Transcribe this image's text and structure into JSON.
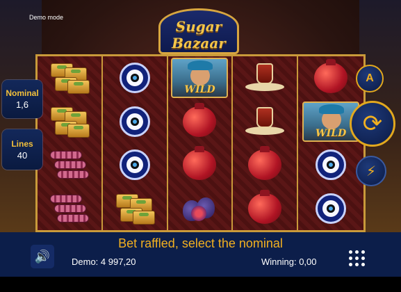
{
  "header": {
    "mode_label": "Demo mode",
    "logo_line1": "Sugar",
    "logo_line2": "Bazaar"
  },
  "reels": [
    [
      "baklava",
      "baklava",
      "turkish-delight-rolls",
      "turkish-delight-rolls"
    ],
    [
      "evil-eye",
      "evil-eye",
      "evil-eye",
      "baklava"
    ],
    [
      "wild",
      "pomegranate",
      "pomegranate",
      "fig"
    ],
    [
      "turkish-tea",
      "turkish-tea",
      "pomegranate",
      "pomegranate"
    ],
    [
      "pomegranate",
      "wild",
      "evil-eye",
      "evil-eye"
    ]
  ],
  "wild_label": "WILD",
  "info": {
    "nominal_label": "Nominal",
    "nominal_value": "1,6",
    "lines_label": "Lines",
    "lines_value": "40"
  },
  "controls": {
    "auto_label": "A",
    "spin_icon": "spin-arrows-icon",
    "turbo_icon": "lightning-icon"
  },
  "bottom": {
    "message": "Bet raffled, select the nominal",
    "balance": "Demo: 4 997,20",
    "winning": "Winning: 0,00",
    "sound_icon": "speaker-icon",
    "menu_icon": "menu-dots-icon"
  },
  "colors": {
    "accent_gold": "#f2b020",
    "panel_blue": "#0c1e4a",
    "reel_border": "#c99a3a"
  }
}
